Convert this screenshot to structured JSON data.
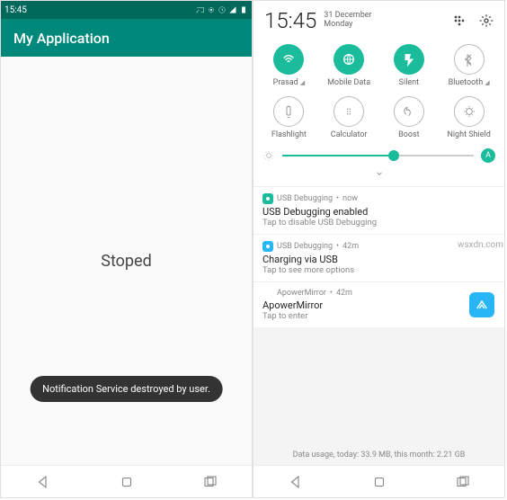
{
  "left": {
    "statusbar_time": "15:45",
    "appbar_title": "My Application",
    "body_text": "Stoped",
    "toast_text": "Notification Service destroyed by user."
  },
  "right": {
    "time": "15:45",
    "date_day": "31 December",
    "date_weekday": "Monday",
    "tiles": [
      {
        "label": "Prasad",
        "state": "on",
        "caret": true
      },
      {
        "label": "Mobile Data",
        "state": "on",
        "caret": false
      },
      {
        "label": "Silent",
        "state": "on",
        "caret": false
      },
      {
        "label": "Bluetooth",
        "state": "off",
        "caret": true
      },
      {
        "label": "Flashlight",
        "state": "off",
        "caret": false
      },
      {
        "label": "Calculator",
        "state": "off",
        "caret": false
      },
      {
        "label": "Boost",
        "state": "off",
        "caret": false
      },
      {
        "label": "Night Shield",
        "state": "off",
        "caret": false
      }
    ],
    "brightness_auto": "A",
    "notifications": [
      {
        "app": "USB Debugging",
        "time": "now",
        "title": "USB Debugging enabled",
        "sub": "Tap to disable USB Debugging",
        "badge": "teal"
      },
      {
        "app": "USB Debugging",
        "time": "42m",
        "title": "Charging via USB",
        "sub": "Tap to see more options",
        "badge": "blue"
      },
      {
        "app": "ApowerMirror",
        "time": "42m",
        "title": "ApowerMirror",
        "sub": "Tap to enter",
        "badge": "none"
      }
    ],
    "data_usage": "Data usage, today: 33.9 MB, this month: 2.21 GB"
  },
  "watermark": "wsxdn.com"
}
